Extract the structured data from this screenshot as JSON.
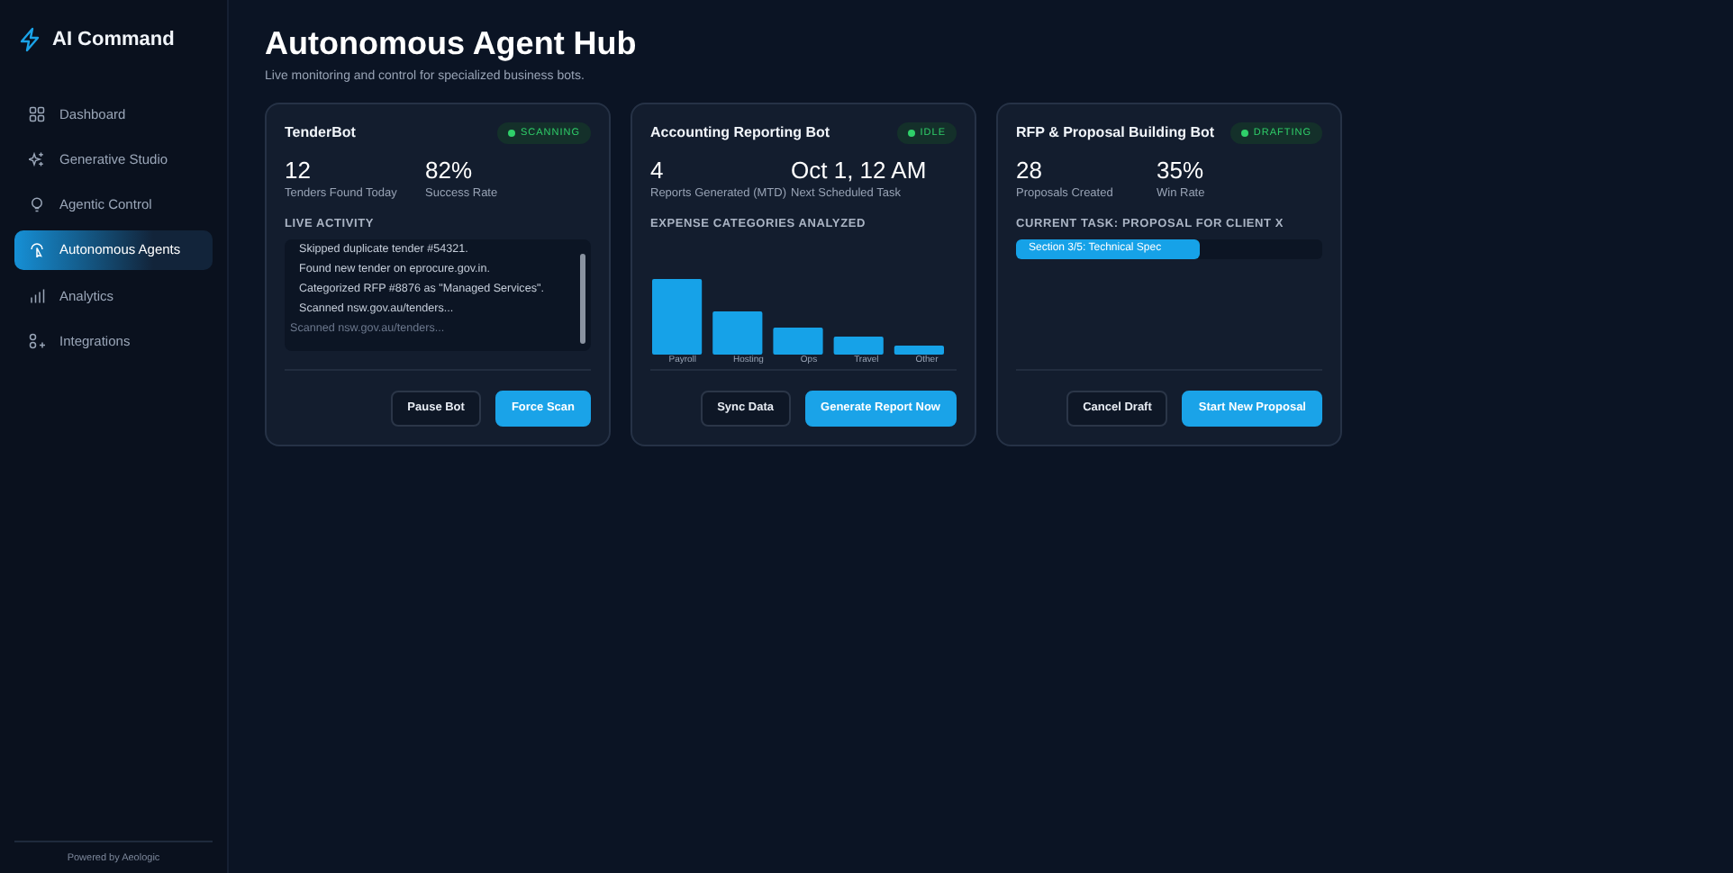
{
  "brand": {
    "name": "AI Command"
  },
  "sidebar": {
    "items": [
      {
        "label": "Dashboard",
        "selected": false
      },
      {
        "label": "Generative Studio",
        "selected": false
      },
      {
        "label": "Agentic Control",
        "selected": false
      },
      {
        "label": "Autonomous Agents",
        "selected": true
      },
      {
        "label": "Analytics",
        "selected": false
      },
      {
        "label": "Integrations",
        "selected": false
      }
    ],
    "footer": "Powered by Aeologic"
  },
  "header": {
    "title": "Autonomous Agent Hub",
    "subtitle": "Live monitoring and control for specialized business bots."
  },
  "bots": [
    {
      "name": "TenderBot",
      "status": "SCANNING",
      "stats": [
        {
          "value": "12",
          "label": "Tenders Found Today"
        },
        {
          "value": "82%",
          "label": "Success Rate"
        }
      ],
      "section_title": "LIVE ACTIVITY",
      "kind": "log",
      "log": [
        {
          "text": "Skipped duplicate tender #54321.",
          "faded": false
        },
        {
          "text": "Found new tender on eprocure.gov.in.",
          "faded": false
        },
        {
          "text": "Categorized RFP #8876 as \"Managed Services\".",
          "faded": false
        },
        {
          "text": "Scanned nsw.gov.au/tenders...",
          "faded": false
        },
        {
          "text": "Scanned nsw.gov.au/tenders...",
          "faded": true
        }
      ],
      "buttons": [
        {
          "label": "Pause Bot",
          "primary": false
        },
        {
          "label": "Force Scan",
          "primary": true
        }
      ]
    },
    {
      "name": "Accounting Reporting Bot",
      "status": "IDLE",
      "stats": [
        {
          "value": "4",
          "label": "Reports Generated (MTD)"
        },
        {
          "value": "Oct 1, 12 AM",
          "label": "Next Scheduled Task"
        }
      ],
      "section_title": "EXPENSE CATEGORIES ANALYZED",
      "kind": "chart",
      "categories": [
        "Payroll",
        "Hosting",
        "Ops",
        "Travel",
        "Other"
      ],
      "buttons": [
        {
          "label": "Sync Data",
          "primary": false
        },
        {
          "label": "Generate Report Now",
          "primary": true
        }
      ]
    },
    {
      "name": "RFP & Proposal Building Bot",
      "status": "DRAFTING",
      "stats": [
        {
          "value": "28",
          "label": "Proposals Created"
        },
        {
          "value": "35%",
          "label": "Win Rate"
        }
      ],
      "section_title": "CURRENT TASK: PROPOSAL FOR CLIENT X",
      "kind": "progress",
      "progress": {
        "label": "Section 3/5: Technical Spec",
        "level": 0.6
      },
      "buttons": [
        {
          "label": "Cancel Draft",
          "primary": false
        },
        {
          "label": "Start New Proposal",
          "primary": true
        }
      ]
    }
  ]
}
